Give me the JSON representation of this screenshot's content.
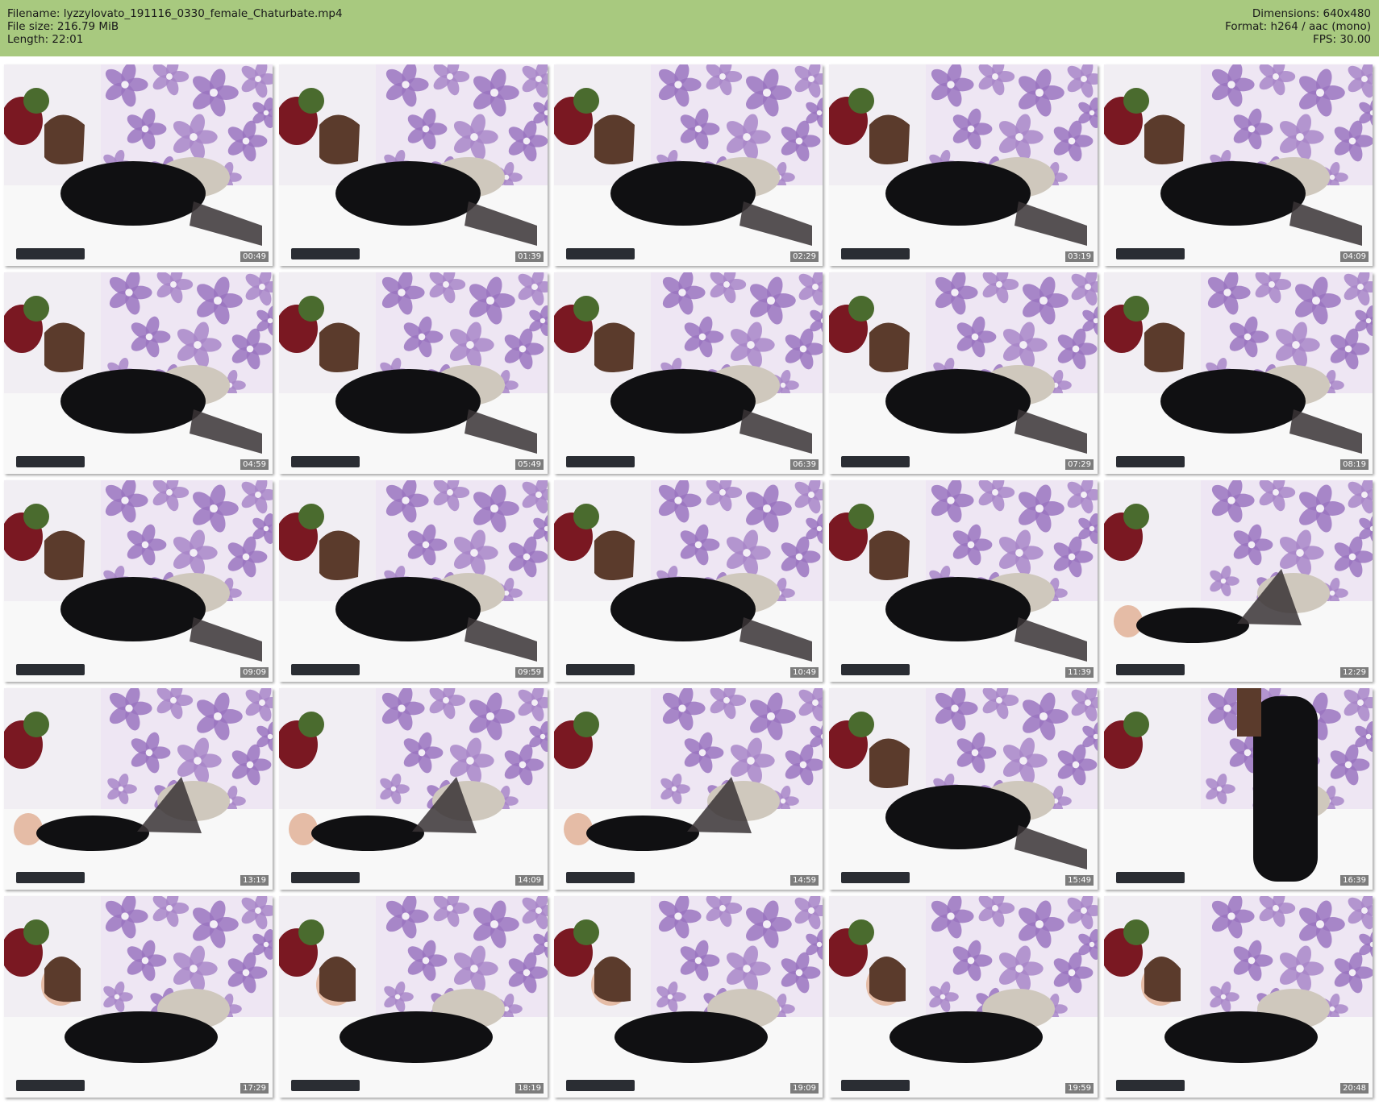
{
  "header": {
    "filename_line": "Filename: lyzzylovato_191116_0330_female_Chaturbate.mp4",
    "filesize_line": "File size: 216.79 MiB",
    "length_line": "Length: 22:01",
    "dimensions_line": "Dimensions: 640x480",
    "format_line": "Format: h264 / aac (mono)",
    "fps_line": "FPS: 30.00"
  },
  "colors": {
    "header_background": "#a8c97f",
    "wallpaper_flower": "#a886c8",
    "dress": "#101012"
  },
  "thumbnails": [
    {
      "timestamp": "00:49",
      "pose": "lying"
    },
    {
      "timestamp": "01:39",
      "pose": "lying"
    },
    {
      "timestamp": "02:29",
      "pose": "lying"
    },
    {
      "timestamp": "03:19",
      "pose": "lying"
    },
    {
      "timestamp": "04:09",
      "pose": "lying"
    },
    {
      "timestamp": "04:59",
      "pose": "lying"
    },
    {
      "timestamp": "05:49",
      "pose": "lying"
    },
    {
      "timestamp": "06:39",
      "pose": "lying"
    },
    {
      "timestamp": "07:29",
      "pose": "lying"
    },
    {
      "timestamp": "08:19",
      "pose": "lying"
    },
    {
      "timestamp": "09:09",
      "pose": "lying"
    },
    {
      "timestamp": "09:59",
      "pose": "lying"
    },
    {
      "timestamp": "10:49",
      "pose": "lying"
    },
    {
      "timestamp": "11:39",
      "pose": "lying"
    },
    {
      "timestamp": "12:29",
      "pose": "legs-up"
    },
    {
      "timestamp": "13:19",
      "pose": "legs-up"
    },
    {
      "timestamp": "14:09",
      "pose": "legs-up"
    },
    {
      "timestamp": "14:59",
      "pose": "legs-up"
    },
    {
      "timestamp": "15:49",
      "pose": "lying"
    },
    {
      "timestamp": "16:39",
      "pose": "standing"
    },
    {
      "timestamp": "17:29",
      "pose": "prone"
    },
    {
      "timestamp": "18:19",
      "pose": "prone"
    },
    {
      "timestamp": "19:09",
      "pose": "prone"
    },
    {
      "timestamp": "19:59",
      "pose": "prone"
    },
    {
      "timestamp": "20:48",
      "pose": "prone"
    }
  ]
}
